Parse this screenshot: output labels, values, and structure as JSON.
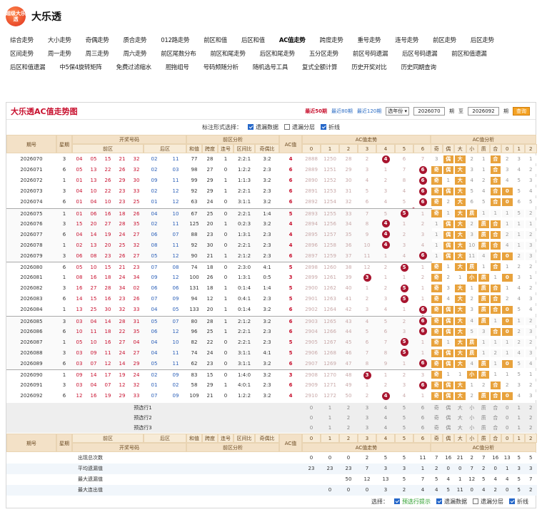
{
  "app": {
    "title": "大乐透",
    "logo_text": "超级大乐透"
  },
  "nav": {
    "active": "AC值走势",
    "items": [
      "综合走势",
      "大小走势",
      "奇偶走势",
      "质合走势",
      "012路走势",
      "前区和值",
      "后区和值",
      "AC值走势",
      "跨度走势",
      "重号走势",
      "连号走势",
      "前区走势",
      "后区走势",
      "区间走势",
      "周一走势",
      "周三走势",
      "周六走势",
      "前区尾数分布",
      "前区和尾走势",
      "后区和尾走势",
      "五分区走势",
      "前区号码遗漏",
      "后区号码遗漏",
      "前区和值遗漏",
      "后区和值遗漏",
      "中5保4旋转矩阵",
      "免费过滤缩水",
      "胆拖组号",
      "号码频随分析",
      "随机选号工具",
      "复式全额计算",
      "历史开奖对比",
      "历史同期查询"
    ]
  },
  "panel": {
    "title": "大乐透AC值走势图",
    "recent": [
      "最近50期",
      "最近80期",
      "最近120期"
    ],
    "year_select": "选年份",
    "from_label": "期",
    "to_label": "至",
    "from_value": "2026070",
    "to_value": "2026092",
    "period_suffix": "期",
    "query": "查询"
  },
  "options": {
    "label": "标注形式选择：",
    "items": [
      {
        "label": "遗漏数据",
        "checked": true
      },
      {
        "label": "遗漏分层",
        "checked": false
      },
      {
        "label": "折线",
        "checked": true
      }
    ]
  },
  "headers": {
    "period": "期号",
    "week": "星期",
    "award": "开奖号码",
    "front": "前区",
    "back": "后区",
    "analysis": "前区分析",
    "sum": "和值",
    "span": "跨度",
    "consec": "连号",
    "ratio": "区间比",
    "parity": "奇偶比",
    "ac": "AC值",
    "ac_trend": "AC值走势",
    "ac_analysis": "AC值分析",
    "ac_cols": [
      "0",
      "1",
      "2",
      "3",
      "4",
      "5",
      "6"
    ],
    "an_cols": [
      "奇",
      "偶",
      "大",
      "小",
      "质",
      "合",
      "0",
      "1",
      "2"
    ]
  },
  "draws": [
    {
      "p": "2026070",
      "w": "3",
      "f": [
        "04",
        "05",
        "15",
        "21",
        "32"
      ],
      "b": [
        "02",
        "11"
      ],
      "sum": "77",
      "span": "28",
      "con": "1",
      "ratio": "2:2:1",
      "par": "3:2",
      "ac": 4,
      "miss": [
        "2888",
        "1250",
        "28",
        "2",
        "",
        "6",
        "7"
      ],
      "an": [
        "3",
        "偶",
        "大",
        "2",
        "1",
        "合",
        "2",
        "3",
        "1"
      ]
    },
    {
      "p": "2026071",
      "w": "6",
      "f": [
        "05",
        "13",
        "22",
        "26",
        "32"
      ],
      "b": [
        "02",
        "03"
      ],
      "sum": "98",
      "span": "27",
      "con": "0",
      "ratio": "1:2:2",
      "par": "2:3",
      "ac": 6,
      "miss": [
        "2889",
        "1251",
        "29",
        "3",
        "1",
        "7",
        ""
      ],
      "an": [
        "奇",
        "偶",
        "大",
        "3",
        "1",
        "合",
        "3",
        "4",
        "2"
      ]
    },
    {
      "p": "2026072",
      "w": "1",
      "f": [
        "01",
        "13",
        "26",
        "29",
        "30"
      ],
      "b": [
        "09",
        "11"
      ],
      "sum": "99",
      "span": "29",
      "con": "1",
      "ratio": "1:1:3",
      "par": "3:2",
      "ac": 6,
      "miss": [
        "2890",
        "1252",
        "30",
        "4",
        "2",
        "8",
        ""
      ],
      "an": [
        "奇",
        "1",
        "大",
        "4",
        "2",
        "合",
        "4",
        "5",
        "3"
      ]
    },
    {
      "p": "2026073",
      "w": "3",
      "f": [
        "04",
        "10",
        "22",
        "23",
        "33"
      ],
      "b": [
        "02",
        "12"
      ],
      "sum": "92",
      "span": "29",
      "con": "1",
      "ratio": "2:2:1",
      "par": "2:3",
      "ac": 6,
      "miss": [
        "2891",
        "1253",
        "31",
        "5",
        "3",
        "4",
        ""
      ],
      "an": [
        "奇",
        "偶",
        "大",
        "5",
        "4",
        "合",
        "0",
        "5",
        "4"
      ]
    },
    {
      "p": "2026074",
      "w": "6",
      "f": [
        "01",
        "04",
        "10",
        "23",
        "25"
      ],
      "b": [
        "01",
        "12"
      ],
      "sum": "63",
      "span": "24",
      "con": "0",
      "ratio": "3:1:1",
      "par": "3:2",
      "ac": 6,
      "miss": [
        "2892",
        "1254",
        "32",
        "6",
        "4",
        "5",
        ""
      ],
      "an": [
        "奇",
        "2",
        "大",
        "6",
        "5",
        "合",
        "0",
        "6",
        "5"
      ]
    },
    {
      "p": "2026075",
      "w": "1",
      "f": [
        "01",
        "06",
        "16",
        "18",
        "26"
      ],
      "b": [
        "04",
        "10"
      ],
      "sum": "67",
      "span": "25",
      "con": "0",
      "ratio": "2:2:1",
      "par": "1:4",
      "ac": 5,
      "miss": [
        "2893",
        "1255",
        "33",
        "7",
        "5",
        "",
        "1"
      ],
      "an": [
        "奇",
        "1",
        "大",
        "质",
        "1",
        "1",
        "1",
        "5",
        "2"
      ]
    },
    {
      "p": "2026076",
      "w": "3",
      "f": [
        "15",
        "20",
        "27",
        "28",
        "35"
      ],
      "b": [
        "02",
        "11"
      ],
      "sum": "125",
      "span": "20",
      "con": "1",
      "ratio": "0:2:3",
      "par": "3:2",
      "ac": 4,
      "miss": [
        "2894",
        "1256",
        "34",
        "8",
        "",
        "1",
        "2"
      ],
      "an": [
        "1",
        "偶",
        "大",
        "2",
        "质",
        "合",
        "1",
        "1",
        "1"
      ]
    },
    {
      "p": "2026077",
      "w": "6",
      "f": [
        "04",
        "14",
        "19",
        "24",
        "27"
      ],
      "b": [
        "06",
        "07"
      ],
      "sum": "88",
      "span": "23",
      "con": "0",
      "ratio": "1:3:1",
      "par": "2:3",
      "ac": 4,
      "miss": [
        "2895",
        "1257",
        "35",
        "9",
        "",
        "2",
        "3"
      ],
      "an": [
        "1",
        "偶",
        "大",
        "3",
        "质",
        "合",
        "2",
        "1",
        "2"
      ]
    },
    {
      "p": "2026078",
      "w": "1",
      "f": [
        "02",
        "13",
        "20",
        "25",
        "32"
      ],
      "b": [
        "08",
        "11"
      ],
      "sum": "92",
      "span": "30",
      "con": "0",
      "ratio": "2:2:1",
      "par": "2:3",
      "ac": 4,
      "miss": [
        "2896",
        "1258",
        "36",
        "10",
        "",
        "3",
        "4"
      ],
      "an": [
        "1",
        "偶",
        "大",
        "10",
        "质",
        "合",
        "4",
        "1",
        "3"
      ]
    },
    {
      "p": "2026079",
      "w": "3",
      "f": [
        "06",
        "08",
        "23",
        "26",
        "27"
      ],
      "b": [
        "05",
        "12"
      ],
      "sum": "90",
      "span": "21",
      "con": "1",
      "ratio": "2:1:2",
      "par": "2:3",
      "ac": 6,
      "miss": [
        "2897",
        "1259",
        "37",
        "11",
        "1",
        "4",
        ""
      ],
      "an": [
        "1",
        "偶",
        "大",
        "11",
        "4",
        "合",
        "0",
        "2",
        "3"
      ]
    },
    {
      "p": "2026080",
      "w": "6",
      "f": [
        "05",
        "10",
        "15",
        "21",
        "23"
      ],
      "b": [
        "07",
        "08"
      ],
      "sum": "74",
      "span": "18",
      "con": "0",
      "ratio": "2:3:0",
      "par": "4:1",
      "ac": 5,
      "miss": [
        "2898",
        "1260",
        "38",
        "12",
        "2",
        "",
        "1"
      ],
      "an": [
        "奇",
        "1",
        "大",
        "质",
        "1",
        "合",
        "1",
        "2",
        "2"
      ]
    },
    {
      "p": "2026081",
      "w": "1",
      "f": [
        "08",
        "16",
        "18",
        "24",
        "34"
      ],
      "b": [
        "09",
        "12"
      ],
      "sum": "100",
      "span": "26",
      "con": "0",
      "ratio": "1:3:1",
      "par": "0:5",
      "ac": 3,
      "miss": [
        "2899",
        "1261",
        "39",
        "",
        "1",
        "1",
        "2"
      ],
      "an": [
        "奇",
        "2",
        "1",
        "小",
        "质",
        "1",
        "0",
        "3",
        "1"
      ]
    },
    {
      "p": "2026082",
      "w": "3",
      "f": [
        "16",
        "27",
        "28",
        "34",
        "02"
      ],
      "b": [
        "06",
        "06"
      ],
      "sum": "131",
      "span": "18",
      "con": "1",
      "ratio": "0:1:4",
      "par": "1:4",
      "ac": 5,
      "miss": [
        "2900",
        "1262",
        "40",
        "1",
        "2",
        "",
        "1"
      ],
      "an": [
        "奇",
        "3",
        "大",
        "1",
        "质",
        "合",
        "1",
        "4",
        "2"
      ]
    },
    {
      "p": "2026083",
      "w": "6",
      "f": [
        "14",
        "15",
        "16",
        "23",
        "26"
      ],
      "b": [
        "07",
        "09"
      ],
      "sum": "94",
      "span": "12",
      "con": "1",
      "ratio": "0:4:1",
      "par": "2:3",
      "ac": 5,
      "miss": [
        "2901",
        "1263",
        "41",
        "2",
        "3",
        "",
        "1"
      ],
      "an": [
        "奇",
        "4",
        "大",
        "2",
        "质",
        "合",
        "2",
        "4",
        "3"
      ]
    },
    {
      "p": "2026084",
      "w": "1",
      "f": [
        "13",
        "25",
        "30",
        "32",
        "33"
      ],
      "b": [
        "04",
        "05"
      ],
      "sum": "133",
      "span": "20",
      "con": "1",
      "ratio": "0:1:4",
      "par": "3:2",
      "ac": 6,
      "miss": [
        "2902",
        "1264",
        "42",
        "3",
        "4",
        "1",
        ""
      ],
      "an": [
        "奇",
        "偶",
        "大",
        "3",
        "质",
        "合",
        "0",
        "5",
        "4"
      ]
    },
    {
      "p": "2026085",
      "w": "3",
      "f": [
        "03",
        "04",
        "14",
        "28",
        "31"
      ],
      "b": [
        "05",
        "07"
      ],
      "sum": "80",
      "span": "28",
      "con": "1",
      "ratio": "2:1:2",
      "par": "3:2",
      "ac": 6,
      "miss": [
        "2903",
        "1265",
        "43",
        "4",
        "5",
        "2",
        ""
      ],
      "an": [
        "奇",
        "偶",
        "大",
        "4",
        "质",
        "1",
        "0",
        "1",
        "2"
      ]
    },
    {
      "p": "2026086",
      "w": "6",
      "f": [
        "10",
        "11",
        "18",
        "22",
        "35"
      ],
      "b": [
        "06",
        "12"
      ],
      "sum": "96",
      "span": "25",
      "con": "1",
      "ratio": "2:2:1",
      "par": "2:3",
      "ac": 6,
      "miss": [
        "2904",
        "1266",
        "44",
        "5",
        "6",
        "3",
        ""
      ],
      "an": [
        "奇",
        "偶",
        "大",
        "5",
        "3",
        "合",
        "0",
        "2",
        "3"
      ]
    },
    {
      "p": "2026087",
      "w": "1",
      "f": [
        "05",
        "10",
        "16",
        "27",
        "04"
      ],
      "b": [
        "04",
        "10"
      ],
      "sum": "82",
      "span": "22",
      "con": "0",
      "ratio": "2:2:1",
      "par": "2:3",
      "ac": 5,
      "miss": [
        "2905",
        "1267",
        "45",
        "6",
        "7",
        "",
        "1"
      ],
      "an": [
        "奇",
        "1",
        "大",
        "质",
        "1",
        "1",
        "1",
        "2",
        "2"
      ]
    },
    {
      "p": "2026088",
      "w": "3",
      "f": [
        "03",
        "09",
        "11",
        "24",
        "27"
      ],
      "b": [
        "04",
        "11"
      ],
      "sum": "74",
      "span": "24",
      "con": "0",
      "ratio": "3:1:1",
      "par": "4:1",
      "ac": 5,
      "miss": [
        "2906",
        "1268",
        "46",
        "7",
        "8",
        "",
        "1"
      ],
      "an": [
        "奇",
        "偶",
        "大",
        "质",
        "1",
        "2",
        "1",
        "4",
        "3"
      ]
    },
    {
      "p": "2026089",
      "w": "6",
      "f": [
        "03",
        "07",
        "12",
        "14",
        "29"
      ],
      "b": [
        "05",
        "11"
      ],
      "sum": "62",
      "span": "23",
      "con": "0",
      "ratio": "3:1:1",
      "par": "3:2",
      "ac": 6,
      "miss": [
        "2907",
        "1269",
        "47",
        "8",
        "9",
        "1",
        ""
      ],
      "an": [
        "奇",
        "偶",
        "大",
        "4",
        "质",
        "1",
        "0",
        "5",
        "4"
      ]
    },
    {
      "p": "2026090",
      "w": "1",
      "f": [
        "09",
        "14",
        "17",
        "19",
        "24"
      ],
      "b": [
        "02",
        "09"
      ],
      "sum": "83",
      "span": "15",
      "con": "0",
      "ratio": "1:4:0",
      "par": "3:2",
      "ac": 3,
      "miss": [
        "2908",
        "1270",
        "48",
        "",
        "1",
        "2",
        "3"
      ],
      "an": [
        "奇",
        "1",
        "1",
        "小",
        "质",
        "1",
        "1",
        "5",
        "1"
      ]
    },
    {
      "p": "2026091",
      "w": "3",
      "f": [
        "03",
        "04",
        "07",
        "12",
        "32"
      ],
      "b": [
        "01",
        "02"
      ],
      "sum": "58",
      "span": "29",
      "con": "1",
      "ratio": "4:0:1",
      "par": "2:3",
      "ac": 6,
      "miss": [
        "2909",
        "1271",
        "49",
        "1",
        "2",
        "3",
        ""
      ],
      "an": [
        "奇",
        "偶",
        "大",
        "1",
        "2",
        "合",
        "2",
        "3",
        "2"
      ]
    },
    {
      "p": "2026092",
      "w": "6",
      "f": [
        "12",
        "16",
        "19",
        "29",
        "33"
      ],
      "b": [
        "07",
        "09"
      ],
      "sum": "109",
      "span": "21",
      "con": "0",
      "ratio": "1:2:2",
      "par": "3:2",
      "ac": 4,
      "miss": [
        "2910",
        "1272",
        "50",
        "2",
        "",
        "4",
        "1"
      ],
      "an": [
        "奇",
        "偶",
        "大",
        "2",
        "质",
        "合",
        "0",
        "4",
        "3"
      ]
    }
  ],
  "predict_labels": [
    "预选行1",
    "预选行2",
    "预选行3"
  ],
  "stats": {
    "rows": [
      {
        "label": "出现总次数",
        "ac": [
          "0",
          "0",
          "0",
          "2",
          "5",
          "5",
          "11"
        ],
        "an": [
          "7",
          "16",
          "21",
          "2",
          "7",
          "16",
          "13",
          "5",
          "5"
        ]
      },
      {
        "label": "平均遗漏值",
        "ac": [
          "23",
          "23",
          "23",
          "7",
          "3",
          "3",
          "1"
        ],
        "an": [
          "2",
          "0",
          "0",
          "7",
          "2",
          "0",
          "1",
          "3",
          "3"
        ]
      },
      {
        "label": "最大遗漏值",
        "ac": [
          "",
          "",
          "50",
          "12",
          "13",
          "5",
          "7"
        ],
        "an": [
          "5",
          "4",
          "1",
          "12",
          "5",
          "4",
          "4",
          "5",
          "7"
        ]
      },
      {
        "label": "最大连出值",
        "ac": [
          "",
          "0",
          "0",
          "0",
          "3",
          "2",
          "4"
        ],
        "an": [
          "4",
          "5",
          "11",
          "0",
          "4",
          "2",
          "0",
          "5",
          "2"
        ]
      }
    ]
  },
  "footer": {
    "label": "选择：",
    "items": [
      {
        "label": "预选行提示",
        "checked": true
      },
      {
        "label": "遗漏数据",
        "checked": true
      },
      {
        "label": "遗漏分层",
        "checked": false
      },
      {
        "label": "折线",
        "checked": true
      }
    ]
  },
  "colors": {
    "red": "#c8102e",
    "blue": "#2b5fb8",
    "header": "#f3e1c7",
    "orange": "#e8a23c"
  }
}
